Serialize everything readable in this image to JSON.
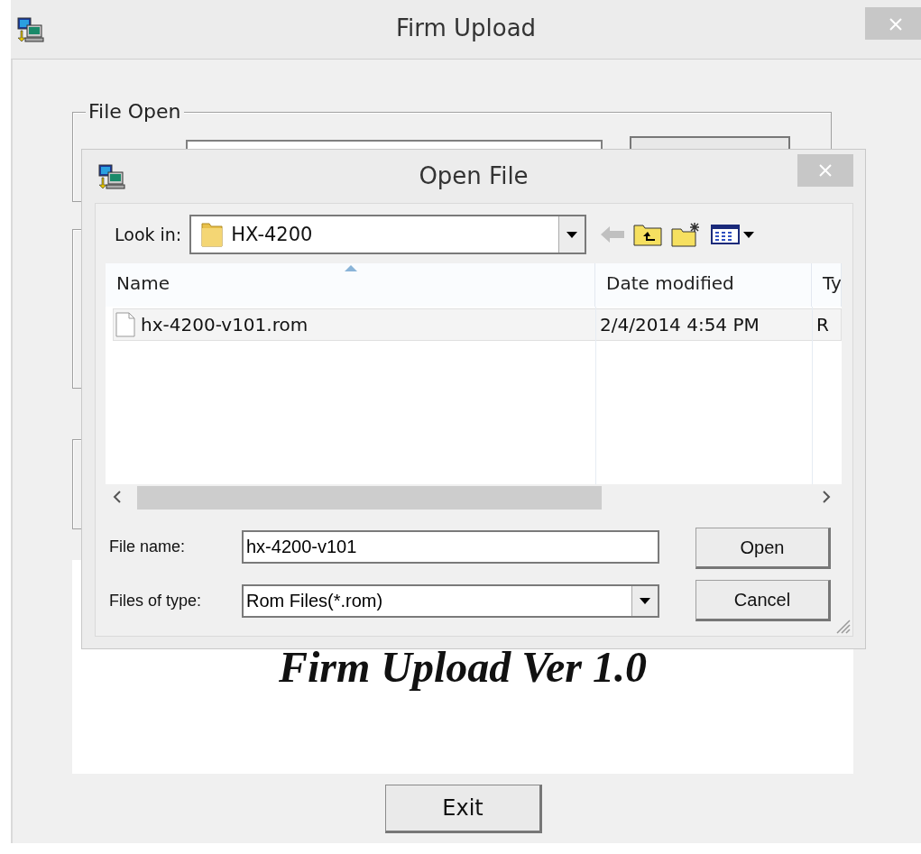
{
  "window": {
    "title": "Firm Upload"
  },
  "file_open_group": {
    "title": "File Open"
  },
  "banner": {
    "text": "Firm Upload Ver 1.0"
  },
  "exit_button": {
    "label": "Exit"
  },
  "dialog": {
    "title": "Open File",
    "look_in": {
      "label": "Look in:",
      "value": "HX-4200"
    },
    "columns": [
      {
        "label": "Name",
        "sorted": true
      },
      {
        "label": "Date modified",
        "sorted": false
      },
      {
        "label": "Ty",
        "sorted": false
      }
    ],
    "rows": [
      {
        "name": "hx-4200-v101.rom",
        "date": "2/4/2014 4:54 PM",
        "type": "R",
        "selected": true
      }
    ],
    "file_name": {
      "label": "File name:",
      "value": "hx-4200-v101"
    },
    "file_type": {
      "label": "Files of type:",
      "value": "Rom Files(*.rom)"
    },
    "buttons": [
      {
        "label": "Open"
      },
      {
        "label": "Cancel"
      }
    ]
  }
}
